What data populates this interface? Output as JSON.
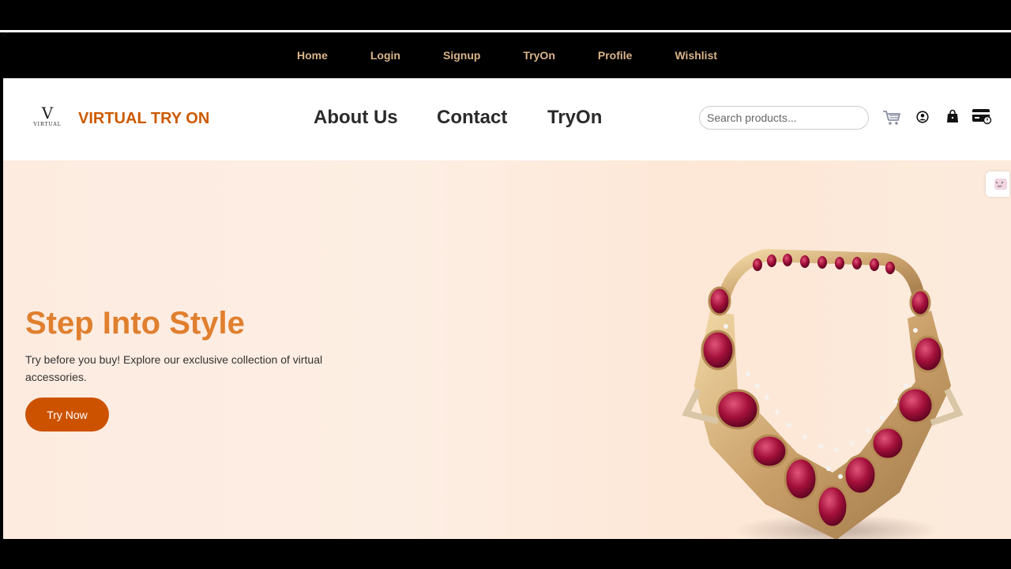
{
  "top_nav": {
    "items": [
      "Home",
      "Login",
      "Signup",
      "TryOn",
      "Profile",
      "Wishlist"
    ]
  },
  "header": {
    "logo": {
      "letter": "V",
      "word": "VIRTUAL"
    },
    "brand": "VIRTUAL TRY ON",
    "nav": [
      "About Us",
      "Contact",
      "TryOn"
    ],
    "search_placeholder": "Search products...",
    "icons": [
      "cart-icon",
      "user-icon",
      "bag-icon",
      "card-icon"
    ]
  },
  "hero": {
    "title": "Step Into Style",
    "text": "Try before you buy! Explore our exclusive collection of virtual accessories.",
    "button": "Try Now",
    "image": "necklace-image"
  },
  "colors": {
    "nav_bg": "#000000",
    "nav_text": "#d9b48a",
    "brand": "#cc5a00",
    "hero_title": "#e07f2e",
    "button": "#cc5200"
  }
}
